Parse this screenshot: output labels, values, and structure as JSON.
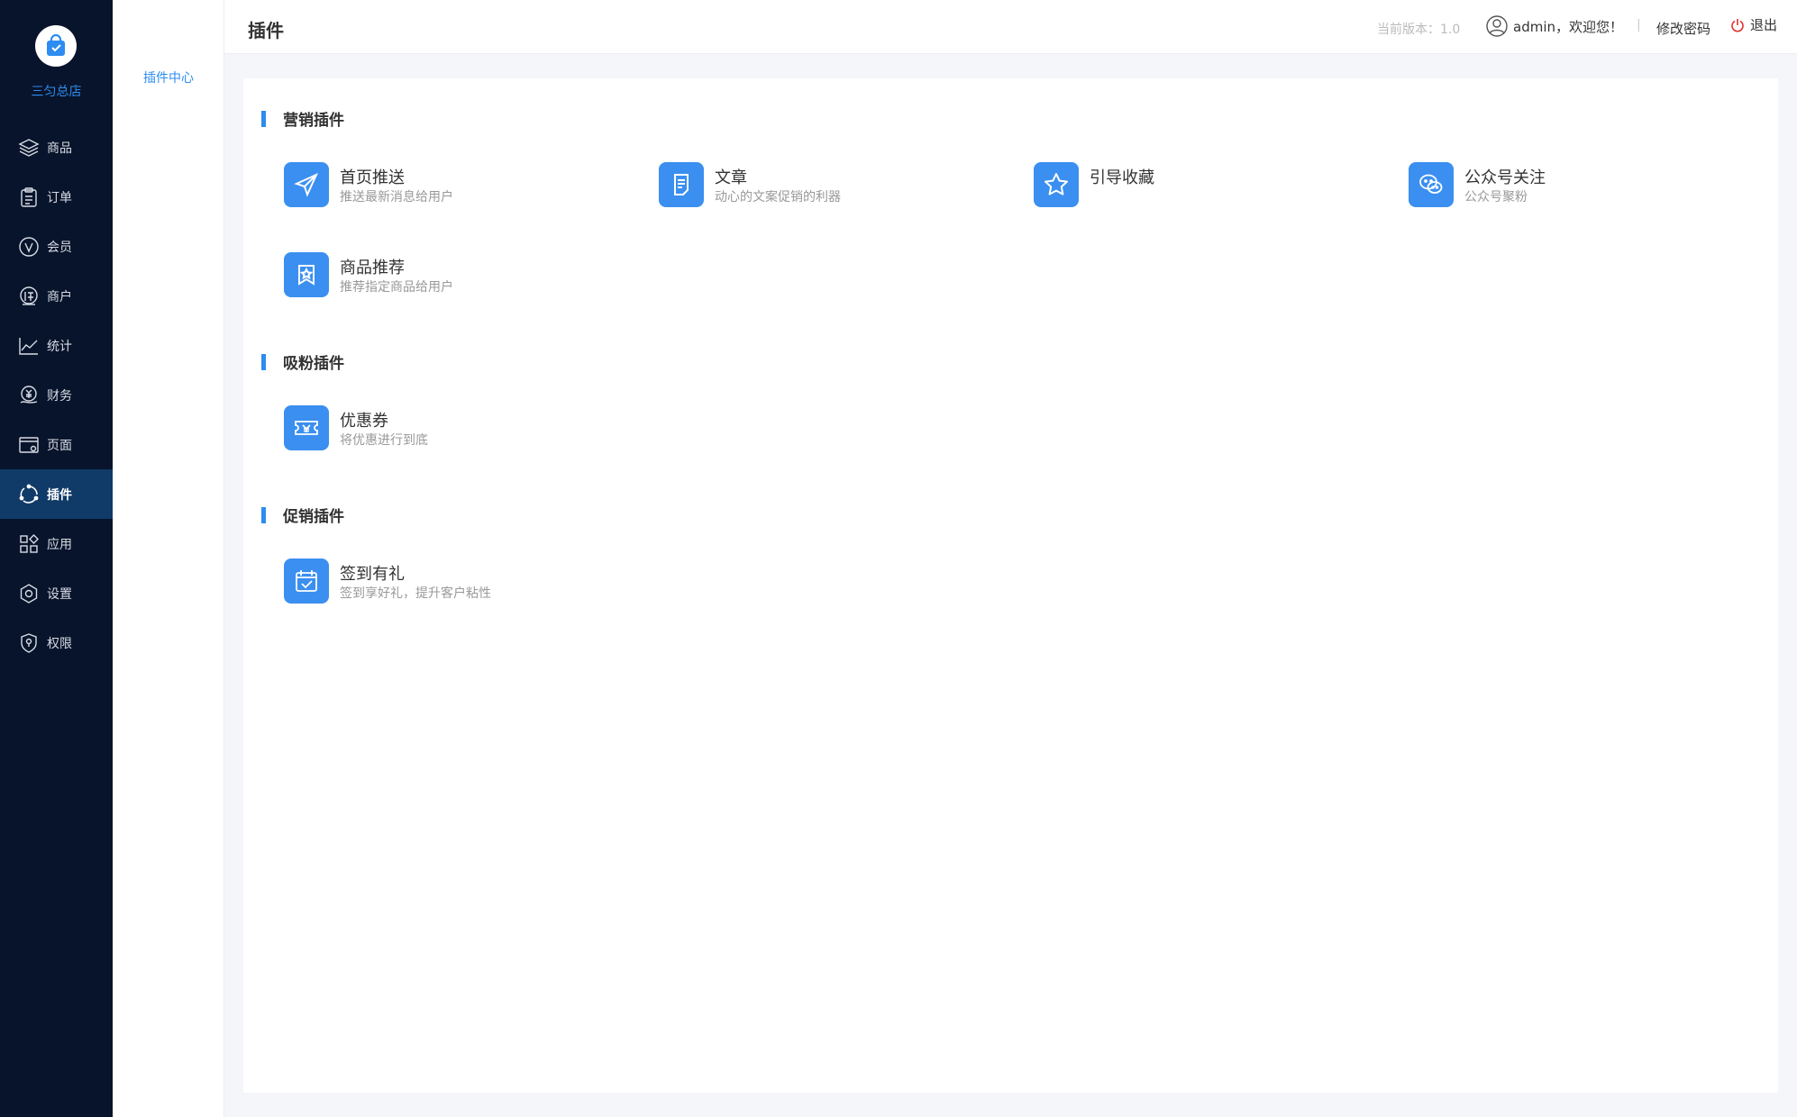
{
  "store": {
    "name": "三匀总店"
  },
  "nav": {
    "items": [
      {
        "label": "商品",
        "icon": "layers-icon"
      },
      {
        "label": "订单",
        "icon": "clipboard-icon"
      },
      {
        "label": "会员",
        "icon": "member-v-icon"
      },
      {
        "label": "商户",
        "icon": "supplier-icon"
      },
      {
        "label": "统计",
        "icon": "chart-line-icon"
      },
      {
        "label": "财务",
        "icon": "finance-icon"
      },
      {
        "label": "页面",
        "icon": "page-icon"
      },
      {
        "label": "插件",
        "icon": "plugin-icon",
        "active": true
      },
      {
        "label": "应用",
        "icon": "apps-icon"
      },
      {
        "label": "设置",
        "icon": "settings-icon"
      },
      {
        "label": "权限",
        "icon": "permission-icon"
      }
    ]
  },
  "subnav": {
    "item": "插件中心"
  },
  "header": {
    "title": "插件",
    "version": "当前版本：1.0",
    "user": "admin，欢迎您！",
    "separator": "|",
    "change_password": "修改密码",
    "logout": "退出"
  },
  "sections": [
    {
      "title": "营销插件",
      "plugins": [
        {
          "name": "首页推送",
          "desc": "推送最新消息给用户",
          "icon": "send-icon"
        },
        {
          "name": "文章",
          "desc": "动心的文案促销的利器",
          "icon": "article-icon"
        },
        {
          "name": "引导收藏",
          "desc": "",
          "icon": "star-icon"
        },
        {
          "name": "公众号关注",
          "desc": "公众号聚粉",
          "icon": "wechat-icon"
        },
        {
          "name": "商品推荐",
          "desc": "推荐指定商品给用户",
          "icon": "recommend-icon"
        }
      ]
    },
    {
      "title": "吸粉插件",
      "plugins": [
        {
          "name": "优惠券",
          "desc": "将优惠进行到底",
          "icon": "coupon-icon"
        }
      ]
    },
    {
      "title": "促销插件",
      "plugins": [
        {
          "name": "签到有礼",
          "desc": "签到享好礼，提升客户粘性",
          "icon": "calendar-check-icon"
        }
      ]
    }
  ],
  "colors": {
    "sidebar_bg": "#08142b",
    "active_bg": "#103a68",
    "accent": "#2d8cf0",
    "icon_bg": "#3b8ff0"
  }
}
